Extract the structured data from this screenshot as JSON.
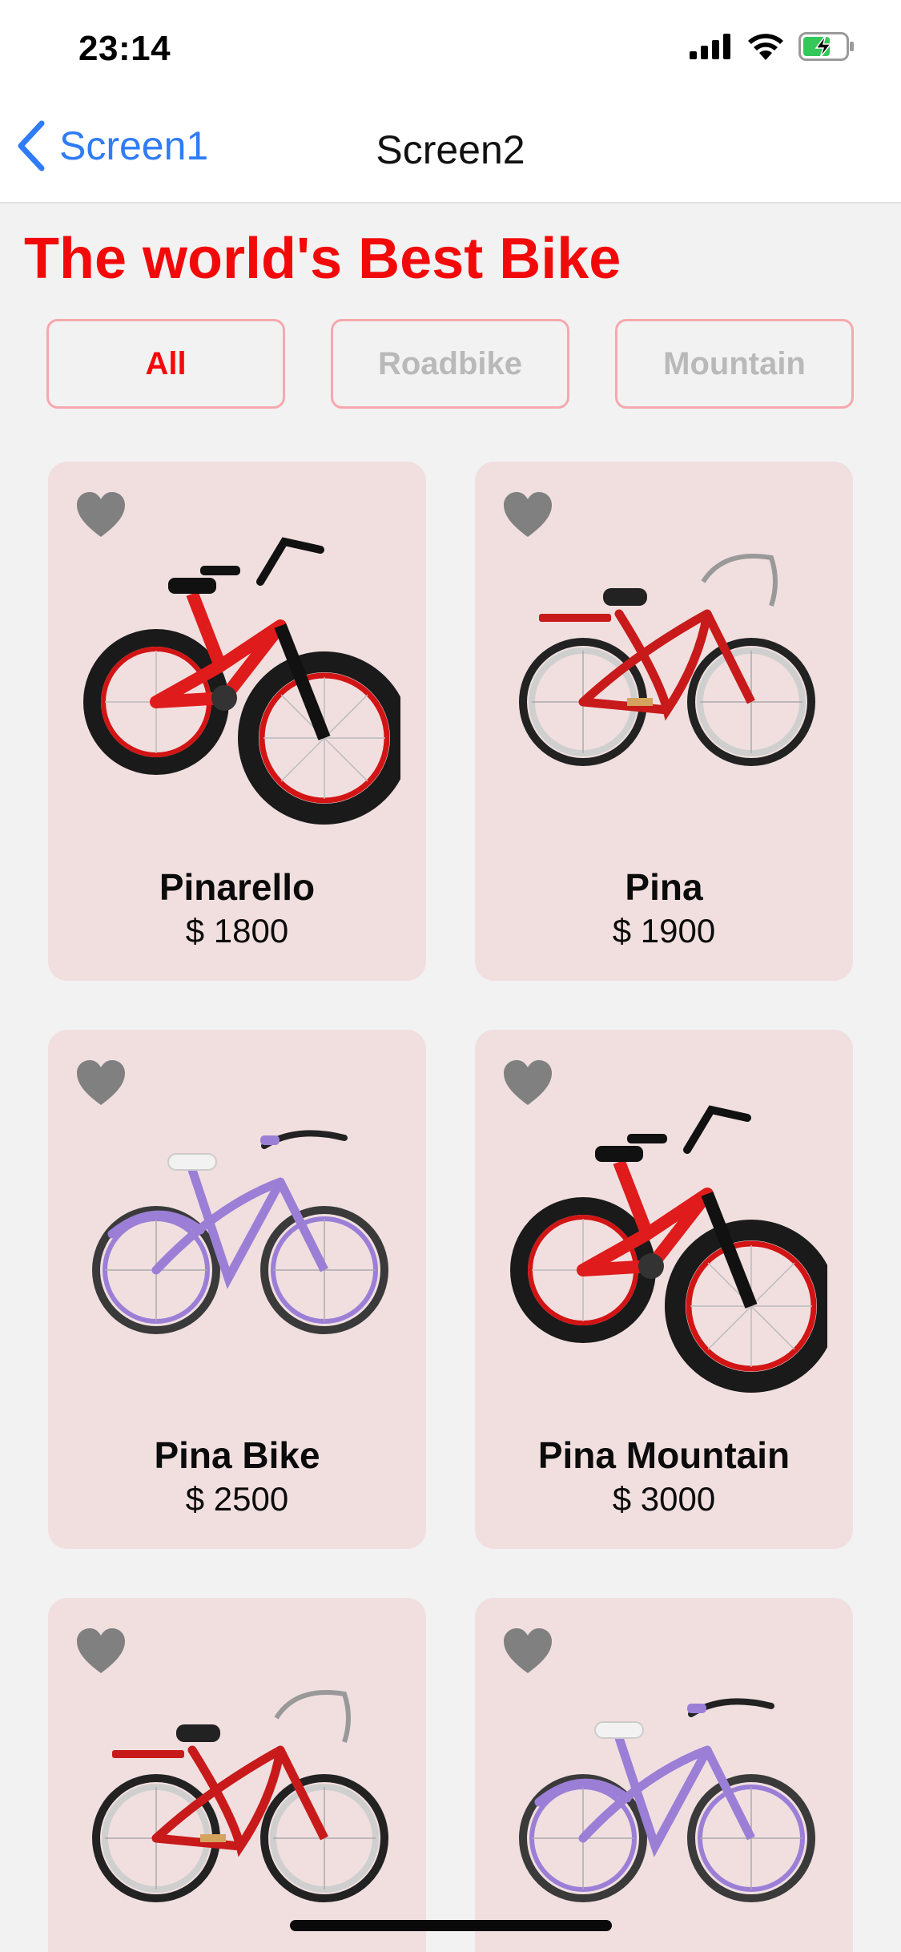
{
  "status_bar": {
    "time": "23:14",
    "icons": [
      "signal-icon",
      "wifi-icon",
      "battery-charging-icon"
    ]
  },
  "nav": {
    "back_label": "Screen1",
    "title": "Screen2"
  },
  "heading": "The world's Best Bike",
  "filters": [
    {
      "label": "All",
      "active": true
    },
    {
      "label": "Roadbike",
      "active": false
    },
    {
      "label": "Mountain",
      "active": false
    }
  ],
  "colors": {
    "accent": "#f20a0a",
    "link": "#2f7cf6",
    "card_bg": "#f1dfe0",
    "heart": "#808080"
  },
  "products": [
    {
      "name": "Pinarello",
      "price": "$ 1800",
      "image": "red-fat-tire-bike"
    },
    {
      "name": "Pina",
      "price": "$ 1900",
      "image": "red-cruiser-bike"
    },
    {
      "name": "Pina Bike",
      "price": "$ 2500",
      "image": "purple-cruiser-bike"
    },
    {
      "name": "Pina Mountain",
      "price": "$ 3000",
      "image": "red-fat-tire-bike"
    },
    {
      "name": "",
      "price": "",
      "image": "red-cruiser-bike"
    },
    {
      "name": "",
      "price": "",
      "image": "purple-cruiser-bike"
    }
  ]
}
